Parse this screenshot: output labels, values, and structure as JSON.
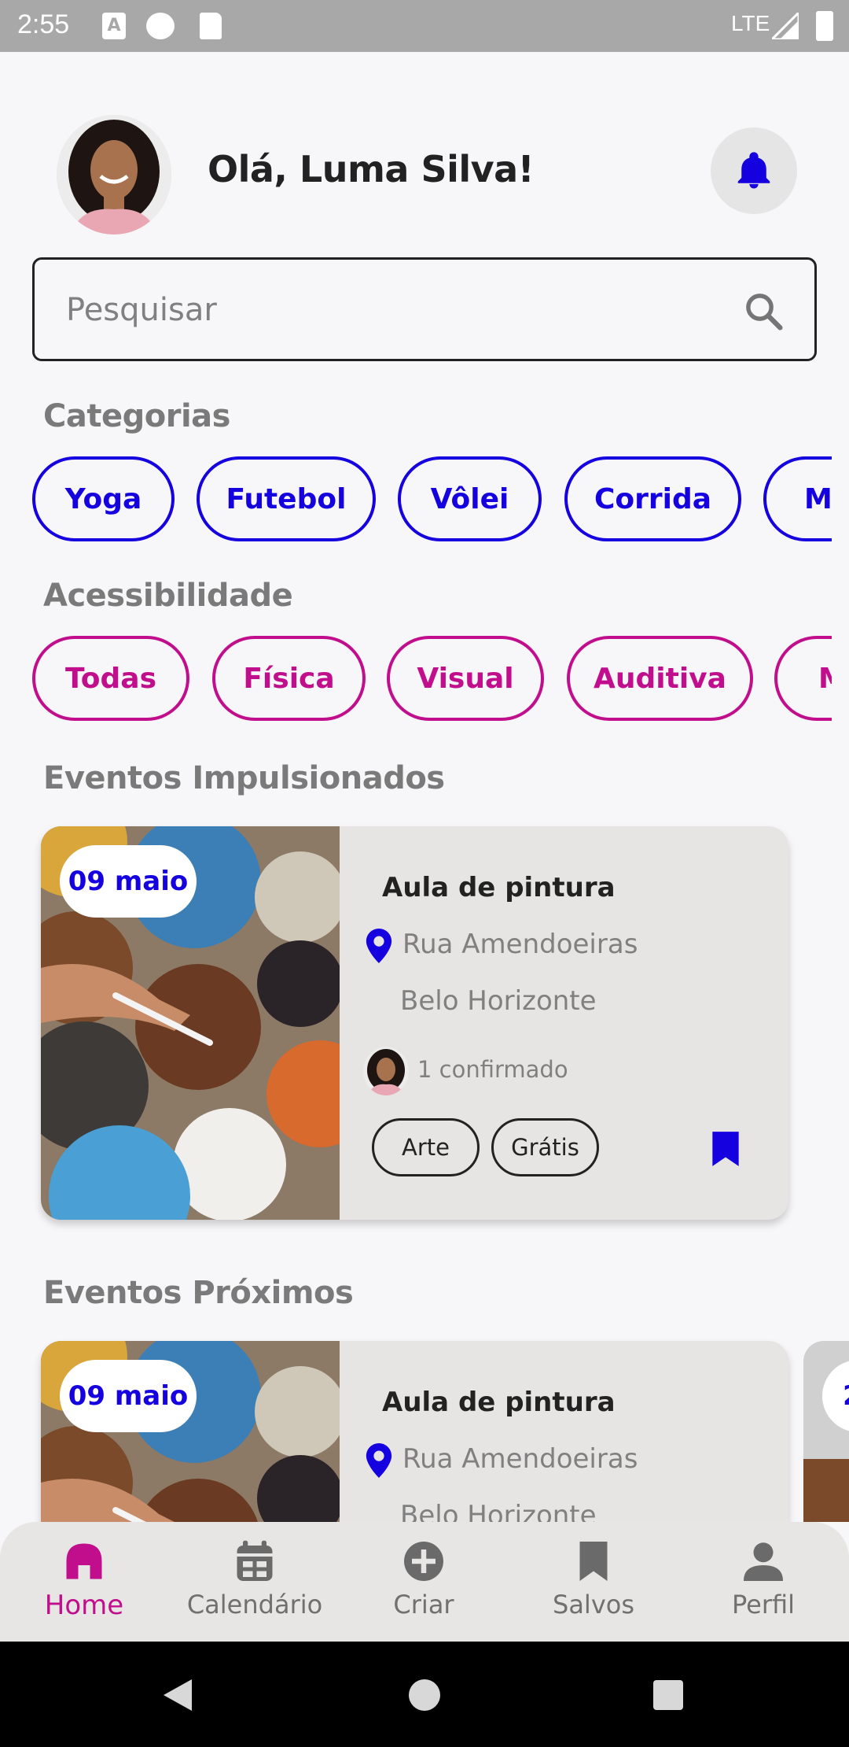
{
  "status_bar": {
    "time": "2:55",
    "network": "LTE",
    "icons": [
      "accessibility-a-icon",
      "app-p-icon",
      "sd-card-icon",
      "signal-icon",
      "battery-icon"
    ]
  },
  "header": {
    "greeting": "Olá, Luma Silva!",
    "avatar_icon": "user-avatar",
    "bell_icon": "bell-icon"
  },
  "search": {
    "placeholder": "Pesquisar",
    "value": ""
  },
  "categories": {
    "title": "Categorias",
    "items": [
      "Yoga",
      "Futebol",
      "Vôlei",
      "Corrida",
      "Me"
    ]
  },
  "accessibility": {
    "title": "Acessibilidade",
    "items": [
      "Todas",
      "Física",
      "Visual",
      "Auditiva",
      "M"
    ]
  },
  "boosted": {
    "title": "Eventos Impulsionados",
    "card": {
      "date": "09 maio",
      "title": "Aula de pintura",
      "street": "Rua Amendoeiras",
      "city": "Belo Horizonte",
      "confirmed": "1 confirmado",
      "tags": [
        "Arte",
        "Grátis"
      ]
    }
  },
  "upcoming": {
    "title": "Eventos Próximos",
    "card": {
      "date": "09 maio",
      "title": "Aula de pintura",
      "street": "Rua Amendoeiras",
      "city": "Belo Horizonte"
    },
    "peek_date": "2"
  },
  "bottom_nav": {
    "items": [
      {
        "label": "Home",
        "icon": "home-icon",
        "active": true
      },
      {
        "label": "Calendário",
        "icon": "calendar-icon"
      },
      {
        "label": "Criar",
        "icon": "plus-circle-icon"
      },
      {
        "label": "Salvos",
        "icon": "bookmark-icon"
      },
      {
        "label": "Perfil",
        "icon": "person-icon"
      }
    ]
  },
  "colors": {
    "primary_blue": "#1500e0",
    "accent_magenta": "#c10e8c",
    "card_bg": "#e6e5e4",
    "page_bg": "#f7f7f9"
  }
}
